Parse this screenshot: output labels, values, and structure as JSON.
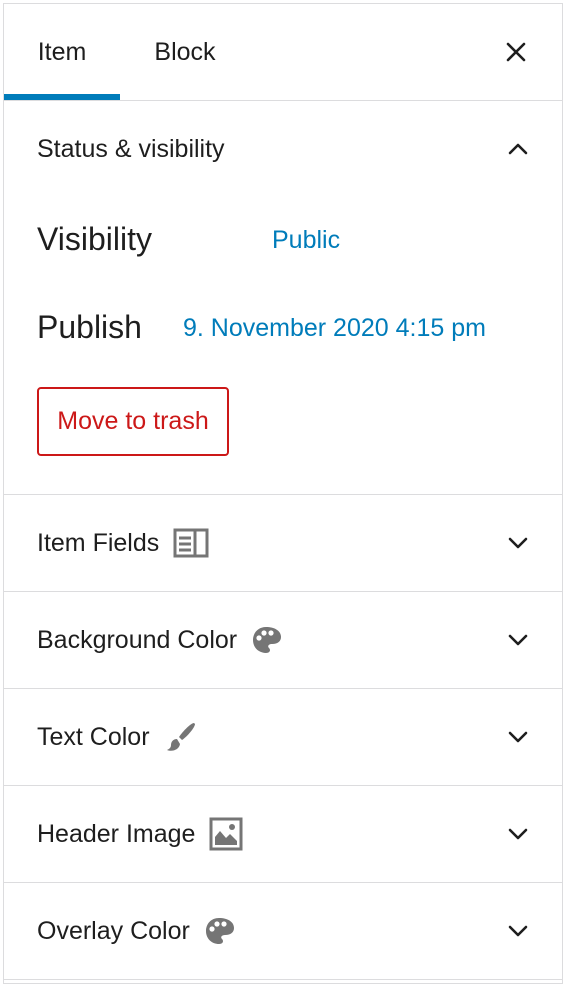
{
  "tabs": {
    "item": "Item",
    "block": "Block"
  },
  "status": {
    "title": "Status & visibility",
    "visibility_label": "Visibility",
    "visibility_value": "Public",
    "publish_label": "Publish",
    "publish_value": "9. November 2020 4:15 pm",
    "trash_label": "Move to trash"
  },
  "panels": {
    "item_fields": "Item Fields",
    "background_color": "Background Color",
    "text_color": "Text Color",
    "header_image": "Header Image",
    "overlay_color": "Overlay Color"
  },
  "colors": {
    "accent": "#007cba",
    "danger": "#cc1818",
    "icon": "#757575",
    "border": "#dcdcde"
  },
  "icons": {
    "close": "close-icon",
    "collapse": "chevron-up-icon",
    "expand": "chevron-down-icon",
    "item_fields": "columns-icon",
    "background_color": "color-palette-icon",
    "text_color": "brush-icon",
    "header_image": "image-icon",
    "overlay_color": "color-palette-icon"
  }
}
